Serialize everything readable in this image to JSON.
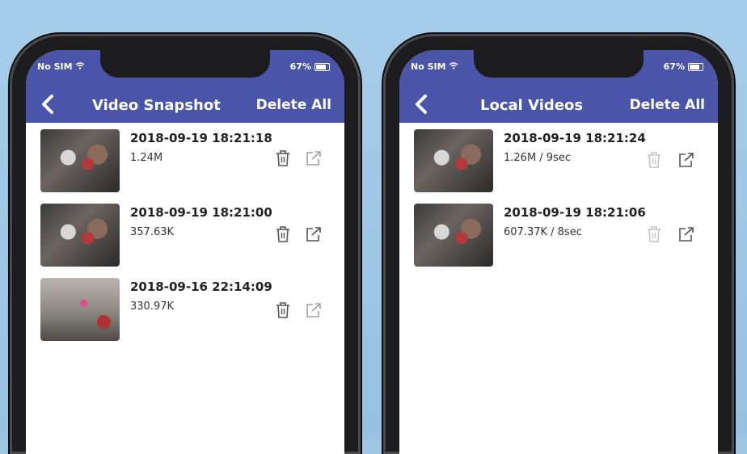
{
  "left_screen": {
    "status": {
      "carrier": "No SIM",
      "battery": "67%"
    },
    "title": "Video Snapshot",
    "delete_all": "Delete All",
    "items": [
      {
        "date": "2018-09-19 18:21:18",
        "size": "1.24M",
        "thumb": "dark"
      },
      {
        "date": "2018-09-19 18:21:00",
        "size": "357.63K",
        "thumb": "dark"
      },
      {
        "date": "2018-09-16 22:14:09",
        "size": "330.97K",
        "thumb": "light"
      }
    ]
  },
  "right_screen": {
    "status": {
      "carrier": "No SIM",
      "battery": "67%"
    },
    "title": "Local Videos",
    "delete_all": "Delete All",
    "items": [
      {
        "date": "2018-09-19 18:21:24",
        "size": "1.26M / 9sec",
        "thumb": "dark"
      },
      {
        "date": "2018-09-19 18:21:06",
        "size": "607.37K / 8sec",
        "thumb": "dark"
      }
    ]
  },
  "colors": {
    "nav_bar": "#4a54a8",
    "background": "#9fc7e4",
    "icon_grey": "#9a9a9a",
    "text_dark": "#222222"
  },
  "icons": {
    "back": "chevron-left-icon",
    "delete": "trash-icon",
    "share": "share-icon",
    "wifi": "wifi-icon",
    "battery": "battery-icon"
  }
}
